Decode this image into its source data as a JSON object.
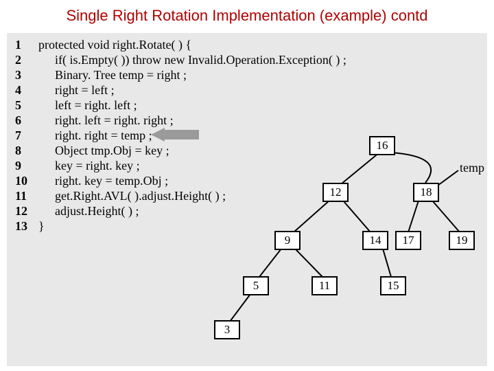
{
  "title": "Single Right Rotation Implementation (example) contd",
  "code": {
    "lines": [
      {
        "n": "1",
        "t": "protected void   right.Rotate( ) {"
      },
      {
        "n": "2",
        "t": "if( is.Empty( )) throw new Invalid.Operation.Exception( ) ;"
      },
      {
        "n": "3",
        "t": "Binary. Tree temp = right ;"
      },
      {
        "n": "4",
        "t": "right = left ;"
      },
      {
        "n": "5",
        "t": "left = right. left ;"
      },
      {
        "n": "6",
        "t": "right. left = right. right ;"
      },
      {
        "n": "7",
        "t": "right. right = temp ;"
      },
      {
        "n": "8",
        "t": "Object tmp.Obj = key ;"
      },
      {
        "n": "9",
        "t": "key = right. key ;"
      },
      {
        "n": "10",
        "t": "right. key = temp.Obj ;"
      },
      {
        "n": "11",
        "t": "get.Right.AVL( ).adjust.Height( ) ;"
      },
      {
        "n": "12",
        "t": "adjust.Height( ) ;"
      },
      {
        "n": "13",
        "t": "}"
      }
    ]
  },
  "labels": {
    "temp": "temp"
  },
  "tree": {
    "nodes": {
      "n16": "16",
      "n12": "12",
      "n18": "18",
      "n9": "9",
      "n14": "14",
      "n17": "17",
      "n19": "19",
      "n5": "5",
      "n11": "11",
      "n15": "15",
      "n3": "3"
    }
  }
}
